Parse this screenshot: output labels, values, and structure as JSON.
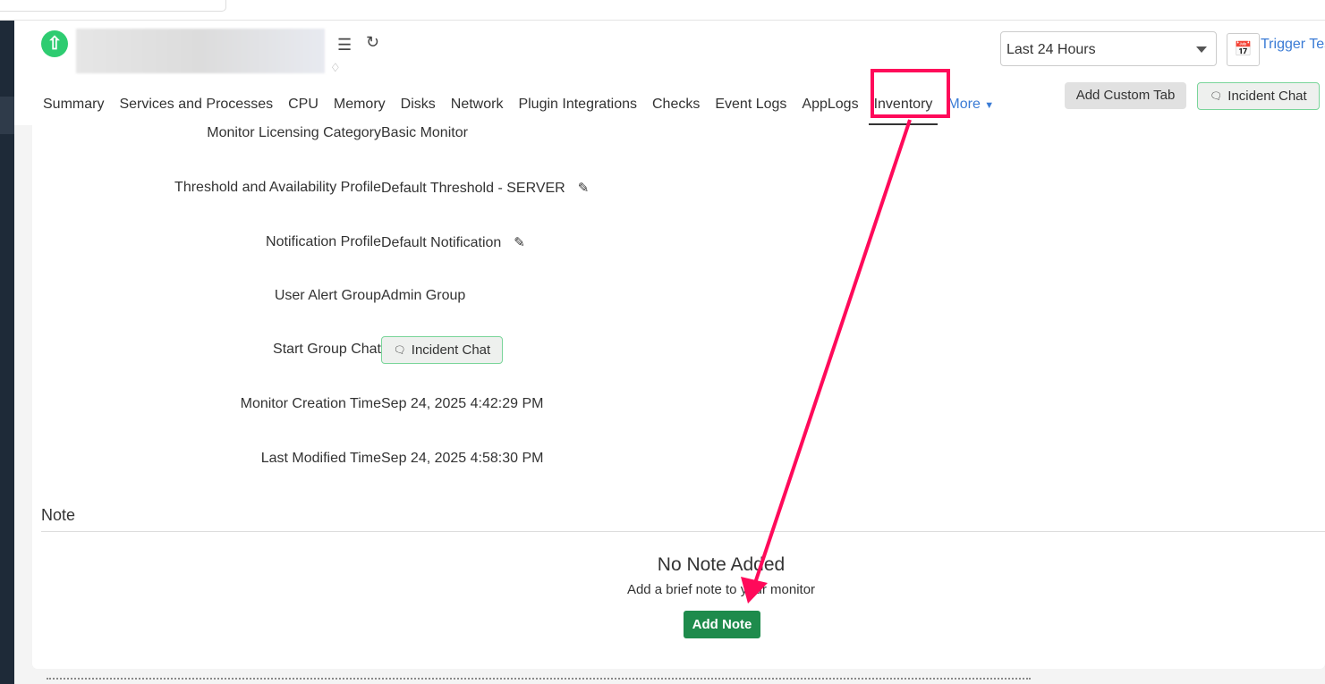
{
  "header": {
    "time_range": "Last 24 Hours",
    "trigger_label": "Trigger Test",
    "add_custom_tab": "Add Custom Tab",
    "incident_chat": "Incident Chat"
  },
  "tabs": [
    {
      "label": "Summary"
    },
    {
      "label": "Services and Processes"
    },
    {
      "label": "CPU"
    },
    {
      "label": "Memory"
    },
    {
      "label": "Disks"
    },
    {
      "label": "Network"
    },
    {
      "label": "Plugin Integrations"
    },
    {
      "label": "Checks"
    },
    {
      "label": "Event Logs"
    },
    {
      "label": "AppLogs"
    },
    {
      "label": "Inventory"
    },
    {
      "label": "More"
    }
  ],
  "details": [
    {
      "label": "Monitor Licensing Category",
      "value": "Basic Monitor"
    },
    {
      "label": "Threshold and Availability Profile",
      "value": "Default Threshold - SERVER"
    },
    {
      "label": "Notification Profile",
      "value": "Default Notification"
    },
    {
      "label": "User Alert Group",
      "value": "Admin Group"
    },
    {
      "label": "Start Group Chat",
      "value": "Incident Chat"
    },
    {
      "label": "Monitor Creation Time",
      "value": "Sep 24, 2025 4:42:29 PM"
    },
    {
      "label": "Last Modified Time",
      "value": "Sep 24, 2025 4:58:30 PM"
    }
  ],
  "note": {
    "title": "Note",
    "empty_title": "No Note Added",
    "empty_sub": "Add a brief note to your monitor",
    "add_button": "Add Note"
  },
  "colors": {
    "accent": "#3a7bd5",
    "annotation": "#ff0a5a",
    "success": "#1e8b4c"
  }
}
